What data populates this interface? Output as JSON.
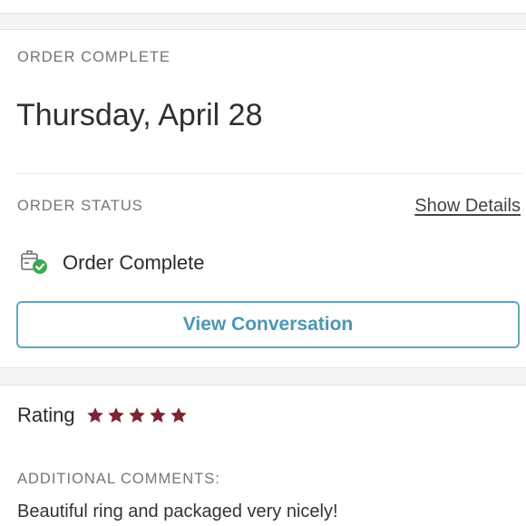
{
  "order": {
    "heading": "ORDER COMPLETE",
    "date": "Thursday, April 28",
    "status_heading": "ORDER STATUS",
    "show_details": "Show Details",
    "status_text": "Order Complete",
    "status_icon": "package-check-icon",
    "view_conversation": "View Conversation"
  },
  "review": {
    "rating_label": "Rating",
    "rating": 5,
    "rating_max": 5,
    "comments_heading": "ADDITIONAL COMMENTS:",
    "comment": "Beautiful ring and packaged very nicely!"
  },
  "colors": {
    "button_border": "#5fa7c0",
    "button_text": "#4c97b4",
    "star": "#7d2432",
    "check": "#3bab4f"
  }
}
